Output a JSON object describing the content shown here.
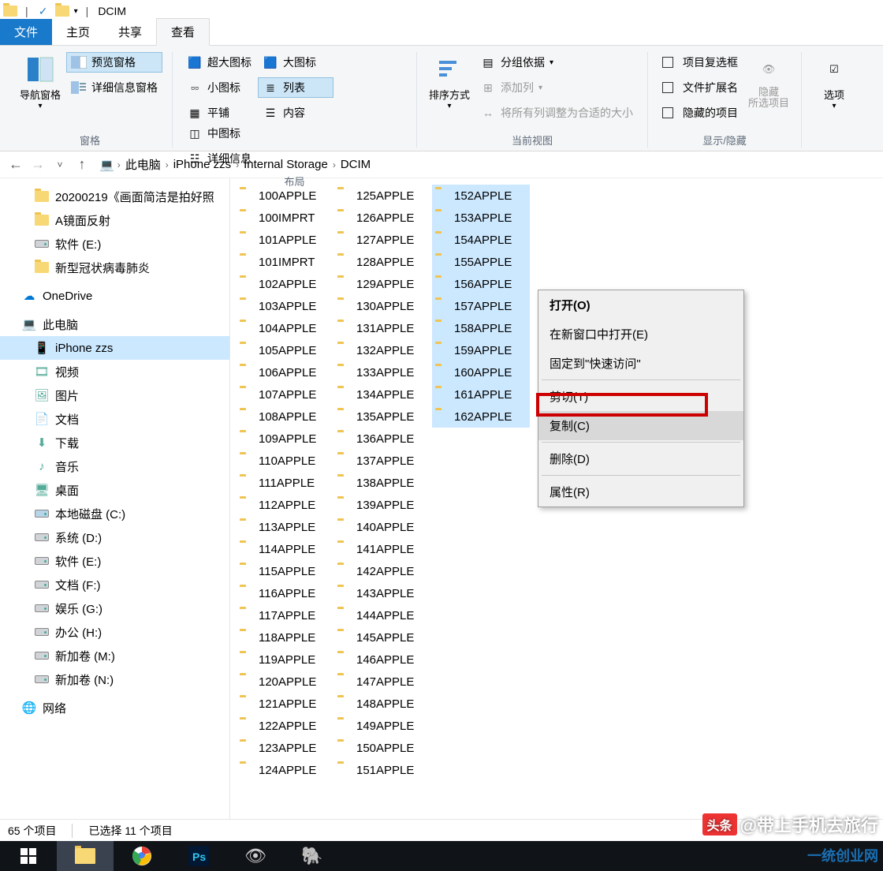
{
  "title": "DCIM",
  "tabs": {
    "file": "文件",
    "home": "主页",
    "share": "共享",
    "view": "查看"
  },
  "ribbon": {
    "panes": {
      "nav": "导航窗格",
      "preview": "预览窗格",
      "details": "详细信息窗格",
      "xl": "超大图标",
      "lg": "大图标",
      "med": "中图标",
      "sm": "小图标",
      "list": "列表",
      "detail": "详细信息",
      "tile": "平铺",
      "content": "内容",
      "sort": "排序方式",
      "group": "分组依据",
      "addcol": "添加列",
      "fitcols": "将所有列调整为合适的大小",
      "chkboxes": "项目复选框",
      "ext": "文件扩展名",
      "hidden": "隐藏的项目",
      "hidebtn": "隐藏\n所选项目",
      "options": "选项"
    },
    "groups": {
      "panes": "窗格",
      "layout": "布局",
      "current": "当前视图",
      "show": "显示/隐藏"
    }
  },
  "breadcrumbs": [
    "此电脑",
    "iPhone zzs",
    "Internal Storage",
    "DCIM"
  ],
  "nav_items": [
    {
      "lvl": 1,
      "icon": "folder",
      "label": "20200219《画面简洁是拍好照"
    },
    {
      "lvl": 1,
      "icon": "folder",
      "label": "A镜面反射"
    },
    {
      "lvl": 1,
      "icon": "drive",
      "label": "软件 (E:)"
    },
    {
      "lvl": 1,
      "icon": "folder",
      "label": "新型冠状病毒肺炎"
    },
    {
      "lvl": 0,
      "icon": "onedrive",
      "label": "OneDrive"
    },
    {
      "lvl": 0,
      "icon": "pc",
      "label": "此电脑"
    },
    {
      "lvl": 1,
      "icon": "phone",
      "label": "iPhone zzs",
      "selected": true
    },
    {
      "lvl": 1,
      "icon": "video",
      "label": "视频"
    },
    {
      "lvl": 1,
      "icon": "picture",
      "label": "图片"
    },
    {
      "lvl": 1,
      "icon": "doc",
      "label": "文档"
    },
    {
      "lvl": 1,
      "icon": "download",
      "label": "下载"
    },
    {
      "lvl": 1,
      "icon": "music",
      "label": "音乐"
    },
    {
      "lvl": 1,
      "icon": "desktop",
      "label": "桌面"
    },
    {
      "lvl": 1,
      "icon": "cdrive",
      "label": "本地磁盘 (C:)"
    },
    {
      "lvl": 1,
      "icon": "drive",
      "label": "系统 (D:)"
    },
    {
      "lvl": 1,
      "icon": "drive",
      "label": "软件 (E:)"
    },
    {
      "lvl": 1,
      "icon": "drive",
      "label": "文档 (F:)"
    },
    {
      "lvl": 1,
      "icon": "drive",
      "label": "娱乐 (G:)"
    },
    {
      "lvl": 1,
      "icon": "drive",
      "label": "办公 (H:)"
    },
    {
      "lvl": 1,
      "icon": "drive",
      "label": "新加卷 (M:)"
    },
    {
      "lvl": 1,
      "icon": "drive",
      "label": "新加卷 (N:)"
    },
    {
      "lvl": 0,
      "icon": "network",
      "label": "网络"
    }
  ],
  "folders_col1": [
    "100APPLE",
    "100IMPRT",
    "101APPLE",
    "101IMPRT",
    "102APPLE",
    "103APPLE",
    "104APPLE",
    "105APPLE",
    "106APPLE",
    "107APPLE",
    "108APPLE",
    "109APPLE",
    "110APPLE",
    "111APPLE",
    "112APPLE",
    "113APPLE",
    "114APPLE",
    "115APPLE",
    "116APPLE",
    "117APPLE",
    "118APPLE",
    "119APPLE",
    "120APPLE",
    "121APPLE",
    "122APPLE",
    "123APPLE",
    "124APPLE"
  ],
  "folders_col2": [
    "125APPLE",
    "126APPLE",
    "127APPLE",
    "128APPLE",
    "129APPLE",
    "130APPLE",
    "131APPLE",
    "132APPLE",
    "133APPLE",
    "134APPLE",
    "135APPLE",
    "136APPLE",
    "137APPLE",
    "138APPLE",
    "139APPLE",
    "140APPLE",
    "141APPLE",
    "142APPLE",
    "143APPLE",
    "144APPLE",
    "145APPLE",
    "146APPLE",
    "147APPLE",
    "148APPLE",
    "149APPLE",
    "150APPLE",
    "151APPLE"
  ],
  "folders_col3": [
    {
      "n": "152APPLE",
      "s": true
    },
    {
      "n": "153APPLE",
      "s": true
    },
    {
      "n": "154APPLE",
      "s": true
    },
    {
      "n": "155APPLE",
      "s": true
    },
    {
      "n": "156APPLE",
      "s": true
    },
    {
      "n": "157APPLE",
      "s": true
    },
    {
      "n": "158APPLE",
      "s": true
    },
    {
      "n": "159APPLE",
      "s": true
    },
    {
      "n": "160APPLE",
      "s": true
    },
    {
      "n": "161APPLE",
      "s": true
    },
    {
      "n": "162APPLE",
      "s": true
    }
  ],
  "context_menu": {
    "open": "打开(O)",
    "newwin": "在新窗口中打开(E)",
    "pin": "固定到\"快速访问\"",
    "cut": "剪切(T)",
    "copy": "复制(C)",
    "delete": "删除(D)",
    "props": "属性(R)"
  },
  "status": {
    "count": "65 个项目",
    "selected": "已选择 11 个项目"
  },
  "watermark": {
    "prefix": "头条",
    "author": "@带上手机去旅行",
    "site": "一统创业网"
  }
}
